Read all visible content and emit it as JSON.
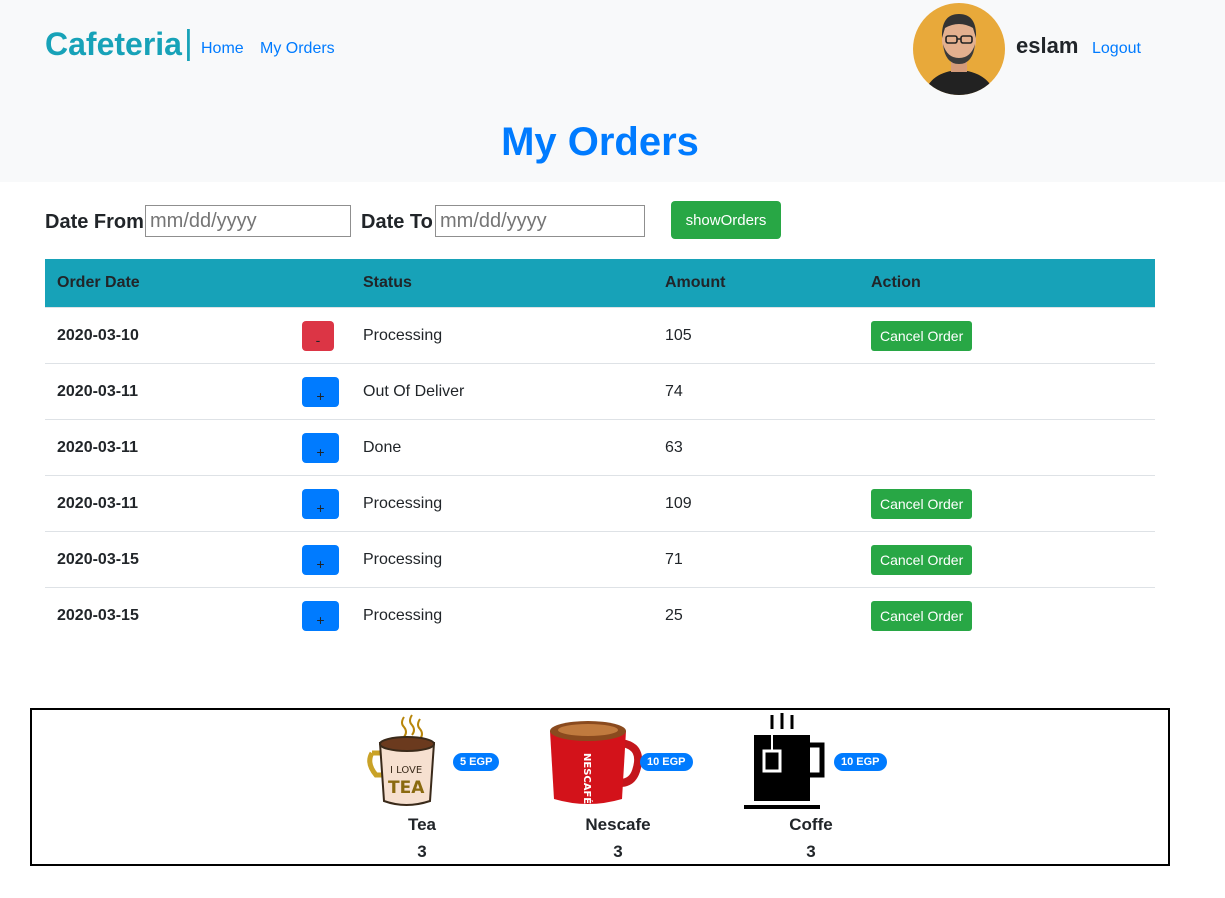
{
  "header": {
    "brand": "Cafeteria",
    "separator": "|",
    "nav": [
      "Home",
      "My Orders"
    ],
    "username": "eslam",
    "logout": "Logout"
  },
  "page_title": "My Orders",
  "filter": {
    "date_from_label": "Date From",
    "date_from_placeholder": "mm/dd/yyyy",
    "date_to_label": "Date To",
    "date_to_placeholder": "mm/dd/yyyy",
    "show_button": "showOrders"
  },
  "table": {
    "headers": [
      "Order Date",
      "",
      "Status",
      "Amount",
      "Action"
    ],
    "rows": [
      {
        "date": "2020-03-10",
        "toggle": "-",
        "status": "Processing",
        "amount": "105",
        "action": "Cancel Order"
      },
      {
        "date": "2020-03-11",
        "toggle": "+",
        "status": "Out Of Deliver",
        "amount": "74",
        "action": ""
      },
      {
        "date": "2020-03-11",
        "toggle": "+",
        "status": "Done",
        "amount": "63",
        "action": ""
      },
      {
        "date": "2020-03-11",
        "toggle": "+",
        "status": "Processing",
        "amount": "109",
        "action": "Cancel Order"
      },
      {
        "date": "2020-03-15",
        "toggle": "+",
        "status": "Processing",
        "amount": "71",
        "action": "Cancel Order"
      },
      {
        "date": "2020-03-15",
        "toggle": "+",
        "status": "Processing",
        "amount": "25",
        "action": "Cancel Order"
      }
    ]
  },
  "items": [
    {
      "name": "Tea",
      "price": "5 EGP",
      "qty": "3",
      "icon": "tea-mug-icon",
      "img_text_1": "I LOVE",
      "img_text_2": "TEA"
    },
    {
      "name": "Nescafe",
      "price": "10 EGP",
      "qty": "3",
      "icon": "nescafe-mug-icon",
      "img_text_1": "NESCAFÉ"
    },
    {
      "name": "Coffe",
      "price": "10 EGP",
      "qty": "3",
      "icon": "coffee-cup-icon"
    }
  ],
  "colors": {
    "brand": "#17a2b8",
    "link": "#007bff",
    "success": "#28a745",
    "danger": "#dc3545",
    "table_header": "#17a2b8"
  }
}
